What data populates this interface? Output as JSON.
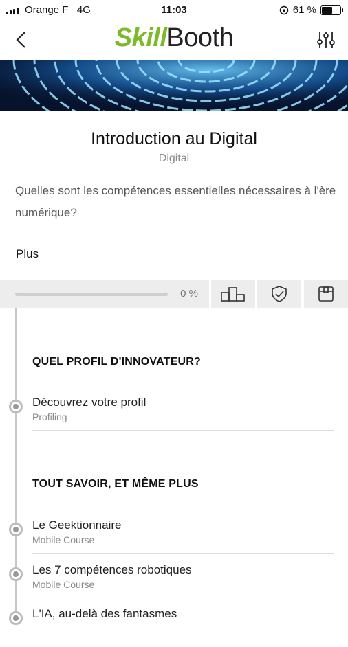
{
  "status_bar": {
    "carrier": "Orange F",
    "network": "4G",
    "time": "11:03",
    "battery": "61 %",
    "battery_level": 0.61
  },
  "nav": {
    "logo_skill": "Skill",
    "logo_booth": "Booth"
  },
  "course": {
    "title": "Introduction au Digital",
    "category": "Digital",
    "description": "Quelles sont les compétences essentielles nécessaires à l'ère numérique?",
    "more_label": "Plus"
  },
  "progress": {
    "percent_text": "0 %",
    "value": 0
  },
  "sections": [
    {
      "title": "QUEL PROFIL D'INNOVATEUR?",
      "items": [
        {
          "title": "Découvrez votre profil",
          "type": "Profiling"
        }
      ]
    },
    {
      "title": "TOUT SAVOIR, ET MÊME PLUS",
      "items": [
        {
          "title": "Le Geektionnaire",
          "type": "Mobile Course"
        },
        {
          "title": "Les 7 compétences robotiques",
          "type": "Mobile Course"
        },
        {
          "title": "L'IA, au-delà des fantasmes",
          "type": ""
        }
      ]
    }
  ],
  "colors": {
    "brand_green": "#7cba2a",
    "action_bg": "#ededed"
  }
}
